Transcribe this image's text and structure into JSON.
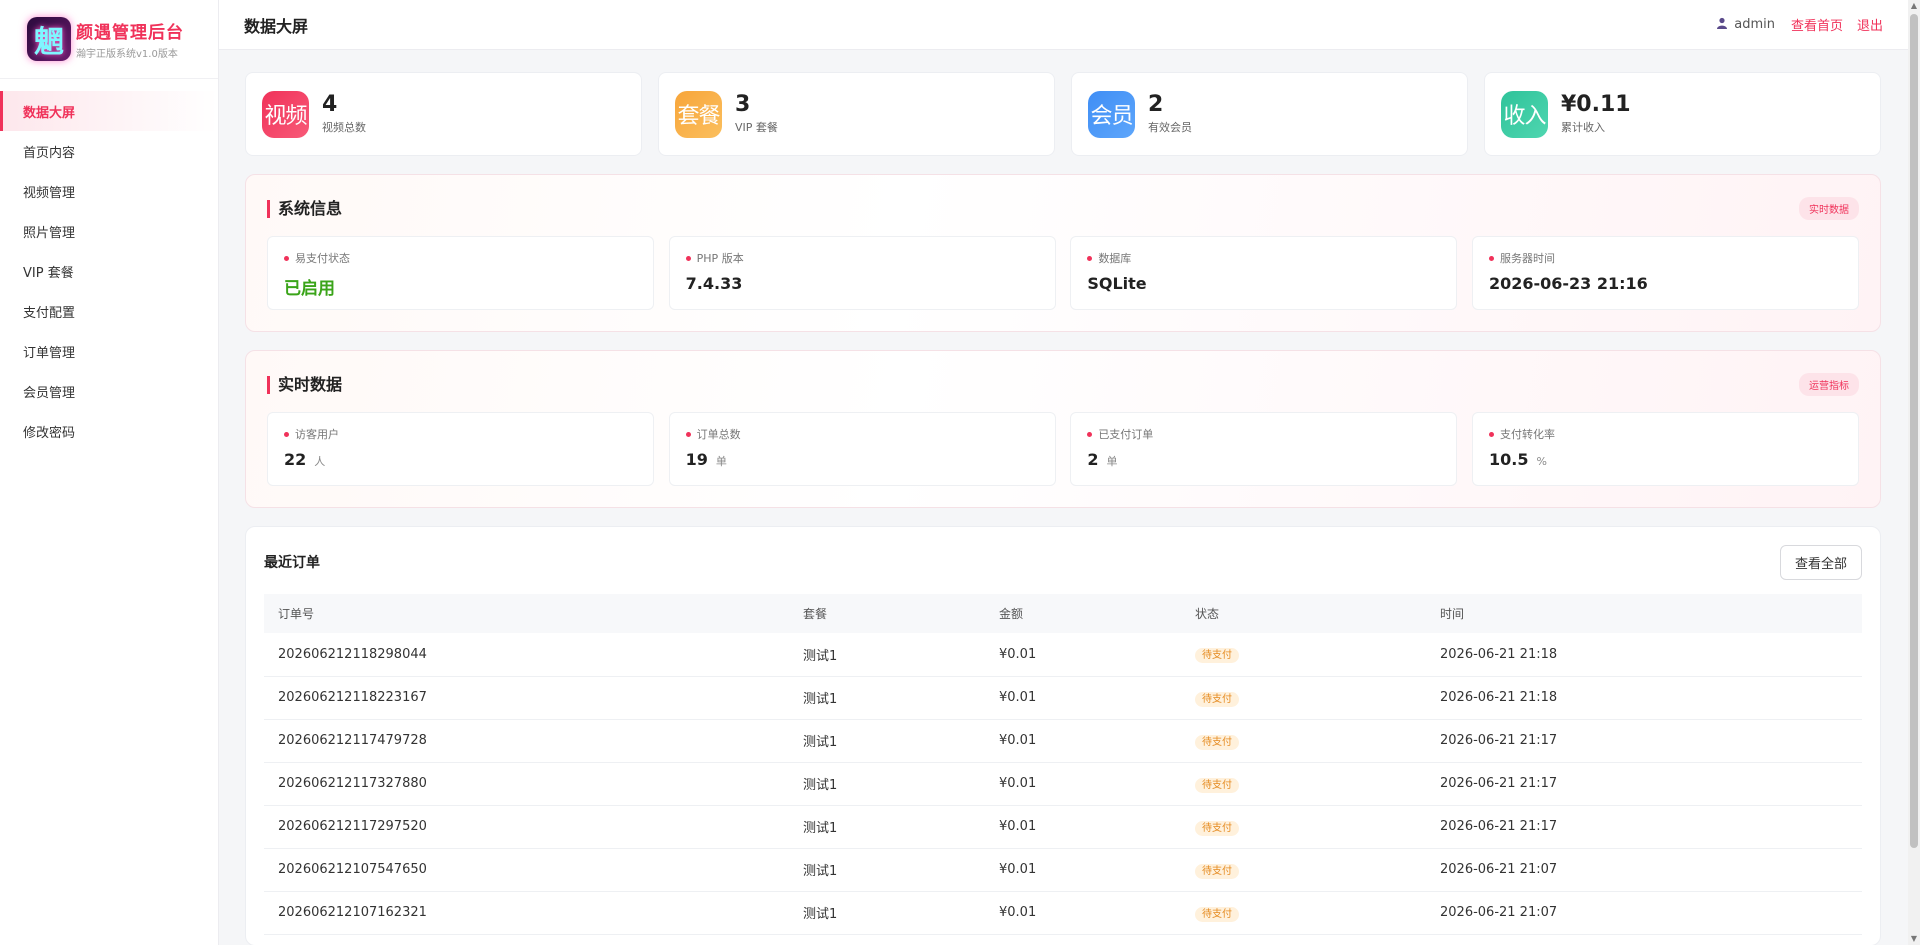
{
  "brand": {
    "logo_char": "魍",
    "title": "颜遇管理后台",
    "subtitle": "瀚宇正版系统v1.0版本"
  },
  "sidebar": {
    "items": [
      {
        "label": "数据大屏"
      },
      {
        "label": "首页内容"
      },
      {
        "label": "视频管理"
      },
      {
        "label": "照片管理"
      },
      {
        "label": "VIP 套餐"
      },
      {
        "label": "支付配置"
      },
      {
        "label": "订单管理"
      },
      {
        "label": "会员管理"
      },
      {
        "label": "修改密码"
      }
    ]
  },
  "header": {
    "title": "数据大屏",
    "user_icon": "user-icon",
    "username": "admin",
    "view_home": "查看首页",
    "logout": "退出"
  },
  "stats": [
    {
      "icon_text": "视频",
      "value": "4",
      "label": "视频总数",
      "color": "#f0325a"
    },
    {
      "icon_text": "套餐",
      "value": "3",
      "label": "VIP 套餐",
      "color": "#f7a53a"
    },
    {
      "icon_text": "会员",
      "value": "2",
      "label": "有效会员",
      "color": "#3f8ef5"
    },
    {
      "icon_text": "收入",
      "value": "¥0.11",
      "label": "累计收入",
      "color": "#2fc39a"
    }
  ],
  "system_info": {
    "title": "系统信息",
    "badge": "实时数据",
    "items": [
      {
        "label": "易支付状态",
        "value": "已启用"
      },
      {
        "label": "PHP 版本",
        "value": "7.4.33"
      },
      {
        "label": "数据库",
        "value": "SQLite"
      },
      {
        "label": "服务器时间",
        "value": "2026-06-23 21:16"
      }
    ]
  },
  "realtime": {
    "title": "实时数据",
    "badge": "运营指标",
    "items": [
      {
        "label": "访客用户",
        "value": "22",
        "unit": "人"
      },
      {
        "label": "订单总数",
        "value": "19",
        "unit": "单"
      },
      {
        "label": "已支付订单",
        "value": "2",
        "unit": "单"
      },
      {
        "label": "支付转化率",
        "value": "10.5",
        "unit": "%"
      }
    ]
  },
  "orders": {
    "title": "最近订单",
    "view_all": "查看全部",
    "columns": [
      "订单号",
      "套餐",
      "金额",
      "状态",
      "时间"
    ],
    "rows": [
      [
        "202606212118298044",
        "测试1",
        "¥0.01",
        "待支付",
        "2026-06-21 21:18"
      ],
      [
        "202606212118223167",
        "测试1",
        "¥0.01",
        "待支付",
        "2026-06-21 21:18"
      ],
      [
        "202606212117479728",
        "测试1",
        "¥0.01",
        "待支付",
        "2026-06-21 21:17"
      ],
      [
        "202606212117327880",
        "测试1",
        "¥0.01",
        "待支付",
        "2026-06-21 21:17"
      ],
      [
        "202606212117297520",
        "测试1",
        "¥0.01",
        "待支付",
        "2026-06-21 21:17"
      ],
      [
        "202606212107547650",
        "测试1",
        "¥0.01",
        "待支付",
        "2026-06-21 21:07"
      ],
      [
        "202606212107162321",
        "测试1",
        "¥0.01",
        "待支付",
        "2026-06-21 21:07"
      ]
    ]
  }
}
